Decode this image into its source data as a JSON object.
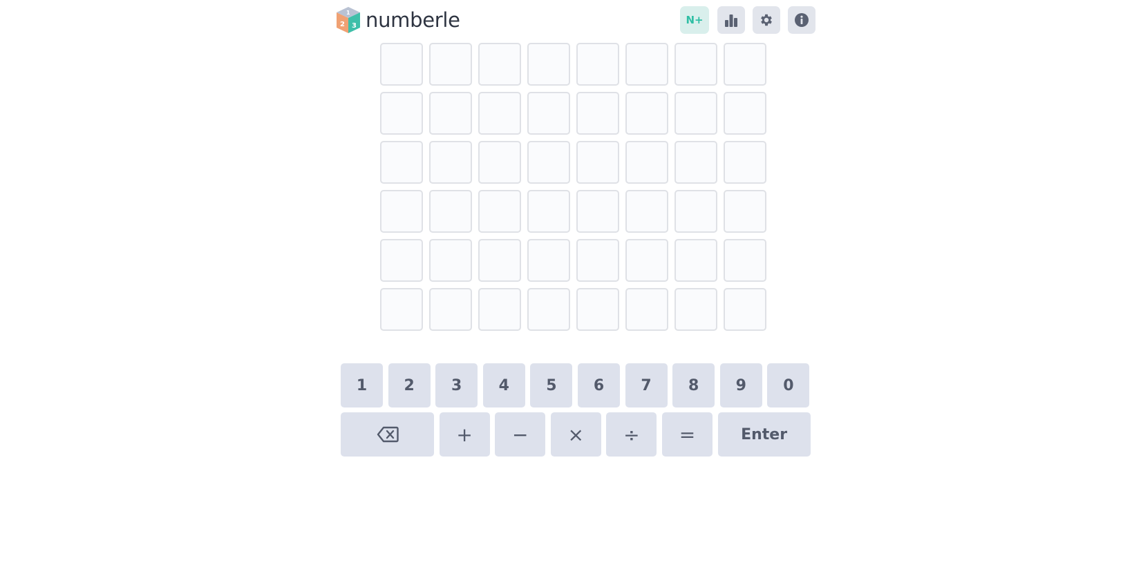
{
  "app": {
    "title": "numberle"
  },
  "header": {
    "logo_icon": "numbered-cube-logo",
    "buttons": [
      {
        "name": "n-plus",
        "label": "N+",
        "color": "#2fbfa5"
      },
      {
        "name": "stats",
        "icon": "bar-chart-icon"
      },
      {
        "name": "settings",
        "icon": "gear-icon"
      },
      {
        "name": "info",
        "icon": "info-icon"
      }
    ]
  },
  "board": {
    "rows": 6,
    "columns": 8
  },
  "keyboard": {
    "digits": [
      "1",
      "2",
      "3",
      "4",
      "5",
      "6",
      "7",
      "8",
      "9",
      "0"
    ],
    "backspace_icon": "backspace-icon",
    "operators": [
      "+",
      "−",
      "×",
      "÷",
      "="
    ],
    "enter_label": "Enter"
  },
  "colors": {
    "key_bg": "#dde1ec",
    "key_text": "#535a6b",
    "accent": "#2fbfa5",
    "tile_border": "#dfe1e6"
  }
}
